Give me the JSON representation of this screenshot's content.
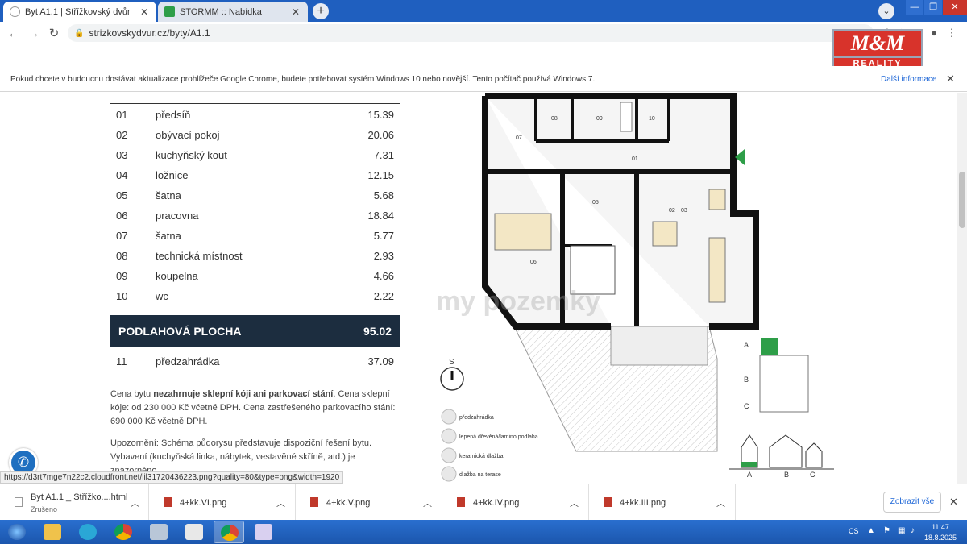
{
  "browser": {
    "tabs": [
      {
        "title": "Byt A1.1 | Střížkovský dvůr",
        "active": true
      },
      {
        "title": "STORMM :: Nabídka",
        "active": false
      }
    ],
    "url": "strizkovskydvur.cz/byty/A1.1",
    "new_tab_label": "+"
  },
  "infobar": {
    "message": "Pokud chcete v budoucnu dostávat aktualizace prohlížeče Google Chrome, budete potřebovat systém Windows 10 nebo novější. Tento počítač používá Windows 7.",
    "more_link": "Další informace"
  },
  "watermark": {
    "logo_top": "M&M",
    "logo_bottom": "REALITY",
    "site_text": "byty domy pozemky"
  },
  "rooms": [
    {
      "num": "01",
      "name": "předsíň",
      "area": "15.39"
    },
    {
      "num": "02",
      "name": "obývací pokoj",
      "area": "20.06"
    },
    {
      "num": "03",
      "name": "kuchyňský kout",
      "area": "7.31"
    },
    {
      "num": "04",
      "name": "ložnice",
      "area": "12.15"
    },
    {
      "num": "05",
      "name": "šatna",
      "area": "5.68"
    },
    {
      "num": "06",
      "name": "pracovna",
      "area": "18.84"
    },
    {
      "num": "07",
      "name": "šatna",
      "area": "5.77"
    },
    {
      "num": "08",
      "name": "technická místnost",
      "area": "2.93"
    },
    {
      "num": "09",
      "name": "koupelna",
      "area": "4.66"
    },
    {
      "num": "10",
      "name": "wc",
      "area": "2.22"
    }
  ],
  "total": {
    "label": "PODLAHOVÁ PLOCHA",
    "value": "95.02"
  },
  "garden": {
    "num": "11",
    "name": "předzahrádka",
    "area": "37.09"
  },
  "notes": {
    "p1_a": "Cena bytu ",
    "p1_bold": "nezahrnuje sklepní kóji ani parkovací stání",
    "p1_b": ". Cena sklepní kóje: od 230 000 Kč včetně DPH. Cena zastřešeného parkovacího stání: 690 000 Kč včetně DPH.",
    "p2": "Upozornění: Schéma půdorysu představuje dispoziční řešení bytu. Vybavení (kuchyňská linka, nábytek, vestavěné skříně, atd.) je znázorněno"
  },
  "plan": {
    "room_labels": [
      "01",
      "02",
      "03",
      "05",
      "06",
      "07",
      "08",
      "09",
      "10"
    ],
    "compass": "S",
    "legend": [
      "předzahrádka",
      "lepená dřevěná/lamino podlaha",
      "keramická dlažba",
      "dlažba na terase"
    ],
    "building_letters": [
      "A",
      "B",
      "C"
    ],
    "section_labels": [
      "A",
      "B",
      "C"
    ]
  },
  "status_url": "https://d3rt7mge7n22c2.cloudfront.net/iil31720436223.png?quality=80&type=png&width=1920",
  "downloads": {
    "items": [
      {
        "name": "Byt A1.1 _ Střížko....html",
        "status": "Zrušeno"
      },
      {
        "name": "4+kk.VI.png",
        "status": ""
      },
      {
        "name": "4+kk.V.png",
        "status": ""
      },
      {
        "name": "4+kk.IV.png",
        "status": ""
      },
      {
        "name": "4+kk.III.png",
        "status": ""
      }
    ],
    "show_all": "Zobrazit vše"
  },
  "taskbar": {
    "lang": "CS",
    "time": "11:47",
    "date": "18.8.2025"
  },
  "colors": {
    "tabstrip": "#1f5fbf",
    "total_bg": "#1c2d3f",
    "plan_green": "#2e9e48"
  }
}
